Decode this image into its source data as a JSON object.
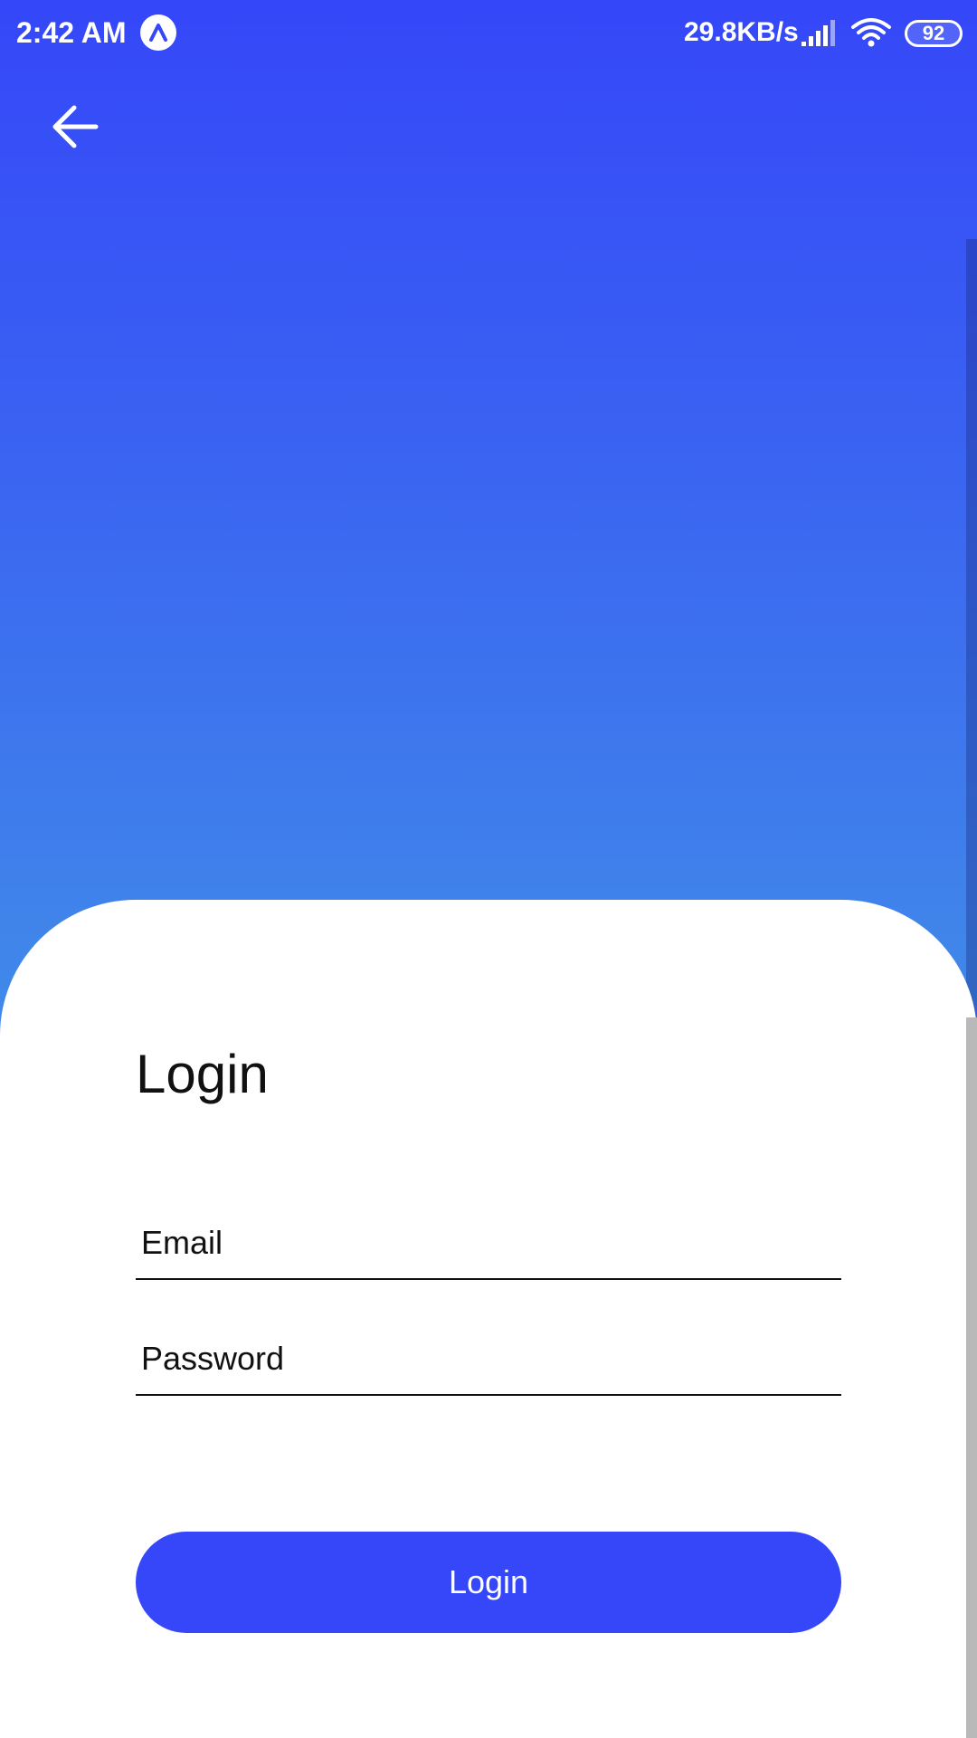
{
  "status_bar": {
    "time": "2:42 AM",
    "network_speed": "29.8KB/s",
    "battery": "92"
  },
  "login": {
    "title": "Login",
    "email_placeholder": "Email",
    "password_placeholder": "Password",
    "button_label": "Login"
  },
  "colors": {
    "primary": "#3547F9",
    "gradient_top": "#3547F9",
    "gradient_bottom": "#44A6E3"
  },
  "icons": {
    "back": "arrow-left-icon",
    "app": "expo-icon",
    "signal": "signal-icon",
    "wifi": "wifi-icon",
    "battery": "battery-icon"
  }
}
